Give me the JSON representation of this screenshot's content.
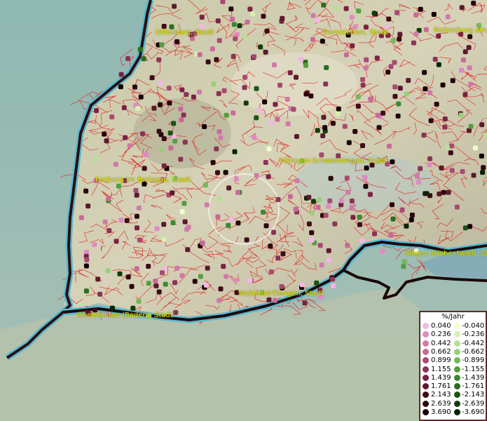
{
  "map": {
    "places": [
      {
        "name": "Offenburg, Stadt"
      },
      {
        "name": "Dornstetten, Stadt"
      },
      {
        "name": "Rottenburg am"
      },
      {
        "name": "Villingen-Schwenningen, Stadt"
      },
      {
        "name": "Freiburg im Breisgau, Stadt"
      },
      {
        "name": "Singen (Hohentwiel), Sta"
      },
      {
        "name": "Waldshut-Tiengen, Stadt"
      },
      {
        "name": "Rheinfelden (Baden), Stadt"
      }
    ],
    "colors": {
      "positive": [
        "#f4b6e6",
        "#e08ac4",
        "#d07aa8",
        "#c86a98",
        "#a84a70",
        "#8a3454",
        "#7a2242",
        "#5c1a2c",
        "#3e0a16",
        "#2a040a",
        "#140004"
      ],
      "negative": [
        "#eeffcc",
        "#d6f0b0",
        "#b6e096",
        "#98d07a",
        "#74b85a",
        "#559e40",
        "#3a8a2e",
        "#2a6e1e",
        "#1c5412",
        "#103c08",
        "#062404"
      ],
      "border": "#e02020",
      "lake": "#5ab8d0",
      "label": "#d8e000"
    }
  },
  "legend": {
    "title": "%/Jahr",
    "positive": [
      "0.040",
      "0.236",
      "0.442",
      "0.662",
      "0.899",
      "1.155",
      "1.439",
      "1.761",
      "2.143",
      "2.639",
      "3.690"
    ],
    "negative": [
      "-0.040",
      "-0.236",
      "-0.442",
      "-0.662",
      "-0.899",
      "-1.155",
      "-1.439",
      "-1.761",
      "-2.143",
      "-2.639",
      "-3.690"
    ]
  }
}
